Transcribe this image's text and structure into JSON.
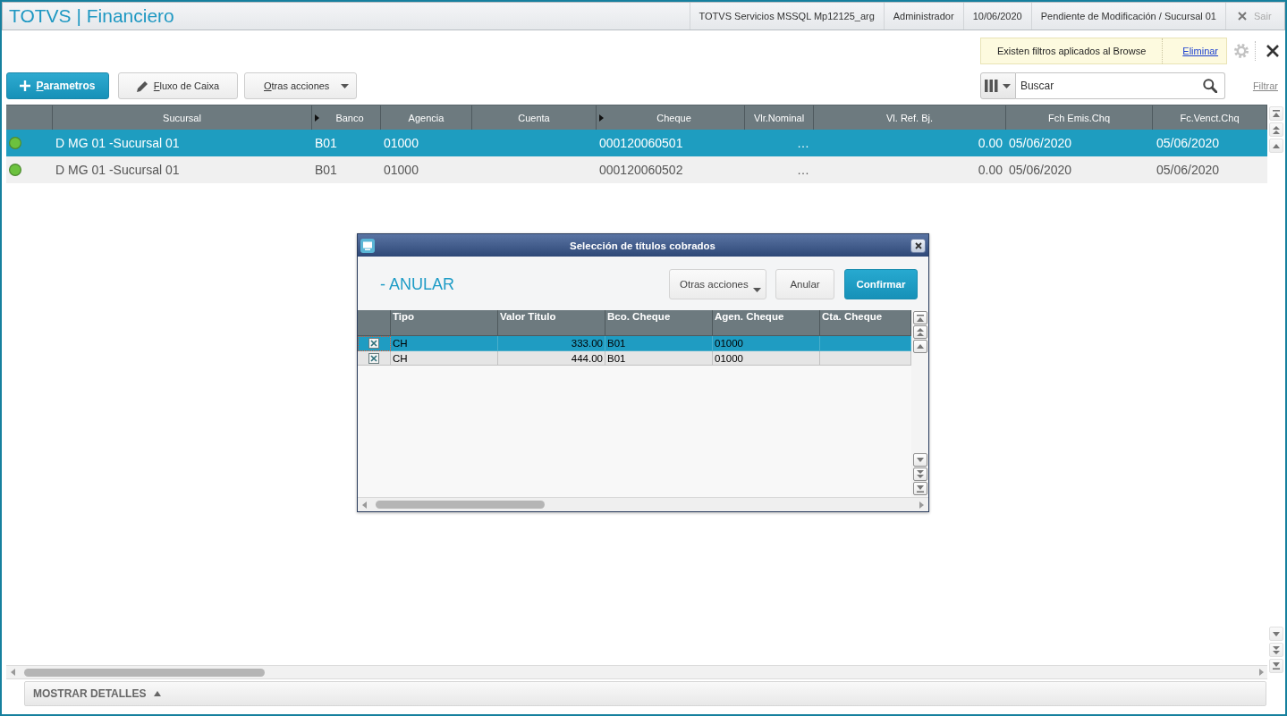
{
  "header": {
    "title": "TOTVS | Financiero",
    "info": [
      "TOTVS Servicios MSSQL Mp12125_arg",
      "Administrador",
      "10/06/2020",
      "Pendiente de Modificación / Sucursal 01"
    ],
    "exit": "Sair"
  },
  "filter_notice": {
    "text": "Existen filtros aplicados al Browse",
    "link": "Eliminar"
  },
  "toolbar": {
    "buttons": [
      {
        "label": "Parametros",
        "kind": "add"
      },
      {
        "label": "Fluxo de Caixa",
        "kind": "edit"
      },
      {
        "label": "Otras acciones",
        "kind": "menu"
      }
    ],
    "search": {
      "placeholder": "Buscar"
    },
    "filter_link": "Filtrar"
  },
  "table": {
    "columns": [
      {
        "label": "Sucursal",
        "marked": false
      },
      {
        "label": "Banco",
        "marked": true
      },
      {
        "label": "Agencia",
        "marked": false
      },
      {
        "label": "Cuenta",
        "marked": false
      },
      {
        "label": "Cheque",
        "marked": true
      },
      {
        "label": "Vlr.Nominal",
        "marked": false
      },
      {
        "label": "Vl. Ref. Bj.",
        "marked": false
      },
      {
        "label": "Fch Emis.Chq",
        "marked": false
      },
      {
        "label": "Fc.Venct.Chq",
        "marked": false
      }
    ],
    "rows": [
      {
        "selected": true,
        "color": "#6cc23e",
        "cells": [
          "D MG 01 -Sucursal 01",
          "B01",
          "01000",
          null,
          "000120060501",
          "…",
          "0.00",
          "05/06/2020",
          "05/06/2020"
        ]
      },
      {
        "selected": false,
        "color": "#6cc23e",
        "cells": [
          "D MG 01 -Sucursal 01",
          "B01",
          "01000",
          null,
          "000120060502",
          "…",
          "0.00",
          "05/06/2020",
          "05/06/2020"
        ]
      }
    ]
  },
  "details_toggle": {
    "label": "MOSTRAR DETALLES"
  },
  "dialog": {
    "title": "Selección de títulos cobrados",
    "heading": "- ANULAR",
    "buttons": [
      {
        "label": "Otras acciones",
        "kind": "menu"
      },
      {
        "label": "Anular",
        "kind": "plain"
      },
      {
        "label": "Confirmar",
        "kind": "primary"
      }
    ],
    "grid": {
      "columns": [
        "Tipo",
        "Valor Titulo",
        "Bco. Cheque",
        "Agen. Cheque",
        "Cta. Cheque"
      ],
      "rows": [
        {
          "selected": true,
          "checked": true,
          "focused": true,
          "cells": [
            "CH",
            "333.00",
            "B01",
            "01000",
            null
          ]
        },
        {
          "selected": false,
          "checked": true,
          "focused": false,
          "cells": [
            "CH",
            "444.00",
            "B01",
            "01000",
            null
          ]
        }
      ]
    }
  }
}
